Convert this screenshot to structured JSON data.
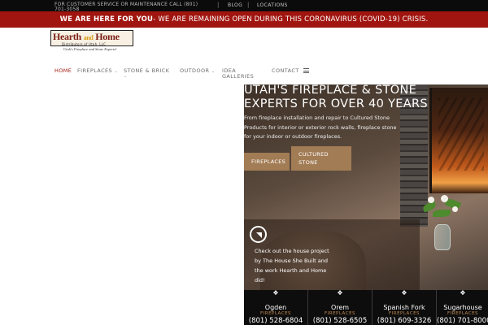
{
  "topbar": {
    "service_text": "FOR CUSTOMER SERVICE OR MAINTENANCE CALL (801) 701-3058",
    "links": [
      "BLOG",
      "LOCATIONS"
    ]
  },
  "alert": {
    "strong": "WE ARE HERE FOR YOU",
    "rest": "- WE ARE REMAINING OPEN DURING THIS CORONAVIRUS (COVID-19) CRISIS."
  },
  "logo": {
    "brand_left": "Hearth",
    "brand_and": "and",
    "brand_right": "Home",
    "sub": "Distributors of Utah, LLC",
    "tagline": "Utah's Fireplace and Stone Experts!"
  },
  "nav": {
    "home": "HOME",
    "fireplaces": "FIREPLACES",
    "stone_brick": "STONE & BRICK",
    "outdoor": "OUTDOOR",
    "idea_galleries_1": "IDEA",
    "idea_galleries_2": "GALLERIES",
    "contact": "CONTACT",
    "chevron": "⌄"
  },
  "hero": {
    "title": "UTAH'S FIREPLACE & STONE EXPERTS FOR OVER 40 YEARS",
    "description": "From fireplace installation and repair to Cultured Stone Products for interior or exterior rock walls, fireplace stone for your indoor or outdoor fireplaces.",
    "button_fireplaces": "FIREPLACES",
    "button_stone_1": "CULTURED",
    "button_stone_2": "STONE",
    "promo_text": "Check out the house project by The House She Built and the work Hearth and Home did!"
  },
  "locations": [
    {
      "name": "Ogden",
      "type": "FIREPLACES",
      "phone": "(801) 528-6804"
    },
    {
      "name": "Orem",
      "type": "FIREPLACES",
      "phone": "(801) 528-6505"
    },
    {
      "name": "Spanish Fork",
      "type": "FIREPLACES",
      "phone": "(801) 609-3326"
    },
    {
      "name": "Sugarhouse",
      "type": "FIREPLACES",
      "phone": "(801) 701-8000"
    }
  ],
  "colors": {
    "accent_red": "#a0150f",
    "button_tan": "#a27c55",
    "location_orange": "#c08a50"
  }
}
